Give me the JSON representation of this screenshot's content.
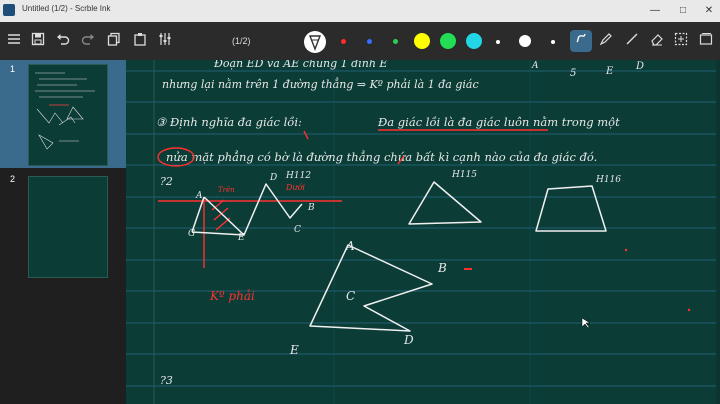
{
  "app": {
    "title": "Untitled (1/2) - Scrble Ink",
    "window_controls": {
      "minimize": "—",
      "maximize": "□",
      "close": "✕"
    }
  },
  "toolbar": {
    "page_indicator": "(1/2)",
    "icons": [
      "menu-icon",
      "save-icon",
      "undo-icon",
      "redo-icon",
      "copy-icon",
      "paste-icon",
      "adjust-icon"
    ],
    "tools_right": [
      "pen-tool",
      "marker-tool",
      "line-tool",
      "eraser-tool",
      "select-tool"
    ],
    "colors": {
      "small_dots": [
        "#ff2a2a",
        "#3a6cff",
        "#2fcf55"
      ],
      "large_swatches": [
        "#ffff00",
        "#22dd55",
        "#22d6e6"
      ],
      "tail_dots": [
        "#ffffff",
        "#ffffff"
      ]
    }
  },
  "sidebar": {
    "pages": [
      {
        "number": "1",
        "selected": true
      },
      {
        "number": "2",
        "selected": false
      }
    ]
  },
  "canvas": {
    "background": "#0b3d36",
    "line_color": "#1f5f74",
    "margin_color": "#2a5a52",
    "handwriting": {
      "line1": "Đoạn ED và AE chung 1 đỉnh E",
      "line2": "nhưng lại nằm trên 1 đường thẳng ⇒ Kº phải là 1 đa giác",
      "line3a": "③ Định nghĩa đa giác lồi:",
      "line3b": "Đa giác lồi là đa giác luôn nằm trong một",
      "line4": "nửa mặt phẳng có bờ là đường thẳng chứa bất kì cạnh nào của đa giác đó.",
      "q2": "?2",
      "q3": "?3",
      "h115": "H115",
      "h116": "H116",
      "ko_phai": "Kº phải",
      "vertex_A": "A",
      "vertex_B": "B",
      "vertex_C": "C",
      "vertex_D": "D",
      "vertex_E": "E",
      "vertex_G": "G",
      "h112": "H112",
      "num5": "5",
      "tren": "Trên",
      "duoi": "Dưới"
    }
  }
}
